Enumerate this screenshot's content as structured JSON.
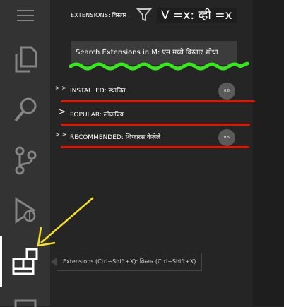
{
  "sidebar": {
    "title": "EXTENSIONS: विस्तार",
    "overlay_text": "V =x: व्ही =x",
    "search": {
      "value": "Search Extensions in M: एम मध्ये विस्तार शोधा"
    },
    "sections": [
      {
        "chevron": "> >",
        "label": "INSTALLED: स्थापित",
        "badge": "0.0"
      },
      {
        "chevron": ">",
        "label": "POPULAR: लोकप्रिय",
        "badge": ""
      },
      {
        "chevron": "> >",
        "label": "RECOMMENDED: शिफारस केलेले",
        "badge": "0.5"
      }
    ]
  },
  "tooltip": {
    "text": "Extensions (Ctrl+Shift+X): विस्तार (Ctrl+Shift+X)"
  },
  "activity_bar": {
    "icons": [
      "menu-icon",
      "explorer-icon",
      "search-icon",
      "source-control-icon",
      "run-debug-icon",
      "extensions-icon",
      "remote-icon"
    ]
  },
  "colors": {
    "activity_bar": "#333333",
    "sidebar": "#252526",
    "annotation_green": "#39e620",
    "annotation_red": "#e51400",
    "annotation_yellow": "#f5e11e"
  }
}
